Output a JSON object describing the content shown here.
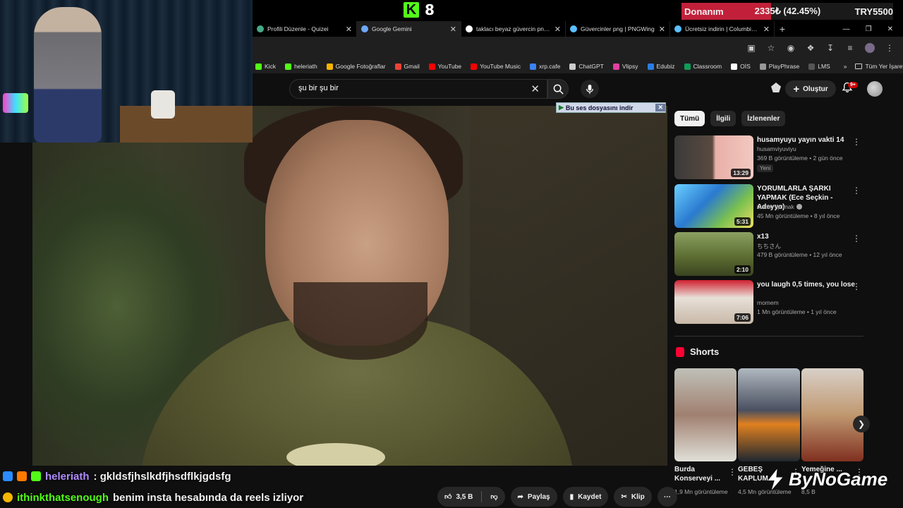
{
  "stream_overlay": {
    "kick_viewers": "8",
    "donation": {
      "title": "Donanım",
      "progress_text": "2335₺ (42.45%)",
      "progress_fraction": 0.4245,
      "goal": "TRY5500",
      "color": "#c2203a"
    }
  },
  "browser": {
    "tabs": [
      {
        "label": "Profili Düzenle - Quizei",
        "icon": "page-icon",
        "color": "#4a8"
      },
      {
        "label": "Google Gemini",
        "icon": "gemini-icon",
        "color": "#6fa8ff"
      },
      {
        "label": "taklacı beyaz güvercin png - Go",
        "icon": "google-icon",
        "color": "#fff"
      },
      {
        "label": "Güvercinler png | PNGWing",
        "icon": "pngwing-icon",
        "color": "#5bc0ff"
      },
      {
        "label": "Ücretsiz indirin | Columbidae Re",
        "icon": "pngwing-icon",
        "color": "#5bc0ff"
      }
    ],
    "bookmarks": [
      {
        "label": "Kick",
        "color": "#53fc18"
      },
      {
        "label": "heleriath",
        "color": "#53fc18"
      },
      {
        "label": "Google Fotoğraflar",
        "color": "#f4b400"
      },
      {
        "label": "Gmail",
        "color": "#ea4335"
      },
      {
        "label": "YouTube",
        "color": "#ff0000"
      },
      {
        "label": "YouTube Music",
        "color": "#ff0000"
      },
      {
        "label": "xrp.cafe",
        "color": "#3b82f6"
      },
      {
        "label": "ChatGPT",
        "color": "#cccccc"
      },
      {
        "label": "Vlipsy",
        "color": "#e040a0"
      },
      {
        "label": "Edubiz",
        "color": "#2a7de1"
      },
      {
        "label": "Classroom",
        "color": "#0f9d58"
      },
      {
        "label": "OİS",
        "color": "#ffffff"
      },
      {
        "label": "PlayPhrase",
        "color": "#999999"
      },
      {
        "label": "LMS",
        "color": "#555555"
      }
    ],
    "all_bookmarks": "Tüm Yer İşaretleri",
    "more": "»"
  },
  "youtube": {
    "search_value": "şu bir şu bir",
    "create_label": "Oluştur",
    "notif_count": "9+",
    "sound_banner": "Bu ses dosyasını indir",
    "chips": [
      "Tümü",
      "İlgili",
      "İzlenenler"
    ],
    "recommendations": [
      {
        "title": "husamyuyu yayın vakti 14",
        "channel": "husamviyuviyu",
        "meta": "369 B görüntüleme • 2 gün önce",
        "duration": "13:29",
        "badge": "Yeni",
        "verified": false
      },
      {
        "title": "YORUMLARLA ŞARKI YAPMAK (Ece Seçkin - Adeyyo)",
        "channel": "Orkun Işıtmak",
        "meta": "45 Mn görüntüleme • 8 yıl önce",
        "duration": "5:31",
        "badge": "",
        "verified": true
      },
      {
        "title": "x13",
        "channel": "ちちさん",
        "meta": "479 B görüntüleme • 12 yıl önce",
        "duration": "2:10",
        "badge": "",
        "verified": false
      },
      {
        "title": "you laugh 0,5 times, you lose",
        "channel": "momem",
        "meta": "1 Mn görüntüleme • 1 yıl önce",
        "duration": "7:06",
        "badge": "",
        "verified": false
      }
    ],
    "shorts_label": "Shorts",
    "shorts": [
      {
        "title": "Burda Konserveyi ...",
        "views": "1,9 Mn görüntüleme"
      },
      {
        "title": "GEBEŞ KAPLUM...",
        "views": "4,5 Mn görüntüleme"
      },
      {
        "title": "Yemeğine ...",
        "views": "8,5 B"
      }
    ],
    "actions": {
      "likes": "3,5 B",
      "share": "Paylaş",
      "save": "Kaydet",
      "clip": "Klip"
    }
  },
  "chat": [
    {
      "user": "heleriath",
      "message": ": gkldsfjhslkdfjhsdflkjgdsfg",
      "user_color": "#b08cff"
    },
    {
      "user": "ithinkthatsenough",
      "message": "benim insta hesabında da reels izliyor",
      "user_color": "#53fc18"
    }
  ],
  "watermark": "ByNoGame"
}
